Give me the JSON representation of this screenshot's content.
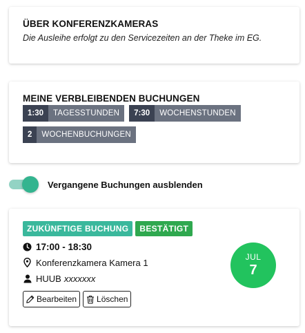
{
  "about": {
    "title": "ÜBER KONFERENZKAMERAS",
    "text": "Die Ausleihe erfolgt zu den Servicezeiten an der Theke im EG."
  },
  "quota": {
    "title": "MEINE VERBLEIBENDEN BUCHUNGEN",
    "chips": [
      {
        "value": "1:30",
        "label": "TAGESSTUNDEN"
      },
      {
        "value": "7:30",
        "label": "WOCHENSTUNDEN"
      },
      {
        "value": "2",
        "label": "WOCHENBUCHUNGEN"
      }
    ]
  },
  "toggle": {
    "label": "Vergangene Buchungen ausblenden",
    "checked": true,
    "color": "#33b48f"
  },
  "booking": {
    "status_badge": "ZUKÜNFTIGE BUCHUNG",
    "confirm_badge": "BESTÄTIGT",
    "time": "17:00 - 18:30",
    "item": "Konferenzkamera Kamera 1",
    "user_name": "HUUB",
    "user_id": "xxxxxxx",
    "edit_label": "Bearbeiten",
    "delete_label": "Löschen",
    "date_month": "JUL",
    "date_day": "7",
    "colors": {
      "future": "#3ab89c",
      "confirmed": "#2fa84f",
      "date_circle": "#22c35e"
    },
    "icons": [
      "clock-icon",
      "location-pin-icon",
      "user-icon",
      "pencil-icon",
      "trash-icon"
    ]
  }
}
